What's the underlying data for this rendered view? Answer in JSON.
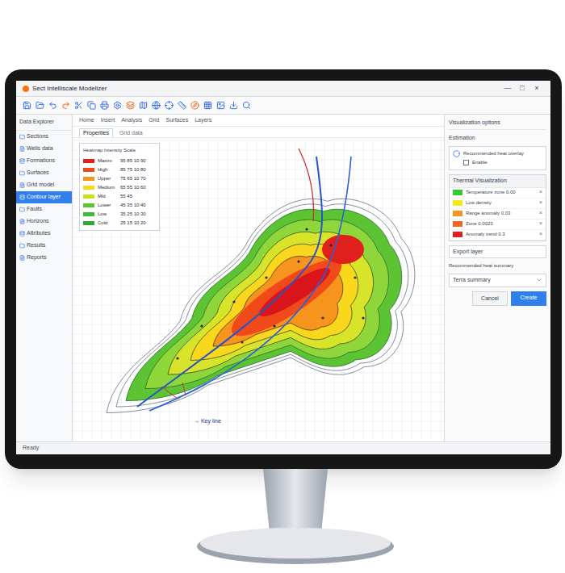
{
  "window": {
    "title": "Sect Intelliscale Modelizer",
    "controls": [
      "—",
      "□",
      "×"
    ]
  },
  "ribbon": [
    "Home",
    "Insert",
    "Analysis",
    "Grid",
    "Surfaces",
    "Layers"
  ],
  "map_tabs": [
    {
      "label": "Properties",
      "selected": true
    },
    {
      "label": "Grid data",
      "selected": false
    }
  ],
  "sidebar": {
    "header": "Data Explorer",
    "items": [
      {
        "label": "Sections",
        "selected": false
      },
      {
        "label": "Wells data",
        "selected": false
      },
      {
        "label": "Formations",
        "selected": false
      },
      {
        "label": "Surfaces",
        "selected": false
      },
      {
        "label": "Grid model",
        "selected": false
      },
      {
        "label": "Contour layer",
        "selected": true
      },
      {
        "label": "Faults",
        "selected": false
      },
      {
        "label": "Horizons",
        "selected": false
      },
      {
        "label": "Attributes",
        "selected": false
      },
      {
        "label": "Results",
        "selected": false
      },
      {
        "label": "Reports",
        "selected": false
      }
    ]
  },
  "legend": {
    "title": "Heatmap Intensity Scale",
    "rows": [
      {
        "label": "Maxim",
        "value": "95 85 10 90",
        "color": "#e0201c"
      },
      {
        "label": "High",
        "value": "85 75 10 80",
        "color": "#f04a1a"
      },
      {
        "label": "Upper",
        "value": "75 65 10 70",
        "color": "#f7941d"
      },
      {
        "label": "Medium",
        "value": "65 55 10 60",
        "color": "#f9d71c"
      },
      {
        "label": "Mid",
        "value": "55 45",
        "color": "#c8e01e"
      },
      {
        "label": "Lower",
        "value": "45 35 10 40",
        "color": "#5cc433"
      },
      {
        "label": "Low",
        "value": "35 25 10 30",
        "color": "#3db83a"
      },
      {
        "label": "Cold",
        "value": "25 15 10 20",
        "color": "#2fa83a"
      }
    ]
  },
  "map": {
    "annotation": "→ Key line"
  },
  "right_panel": {
    "title": "Visualization options",
    "section": "Estimation",
    "option": {
      "label": "Recommended heat overlay",
      "sub": "Enable",
      "checked": false
    },
    "list_title": "Thermal Visualization",
    "list_items": [
      {
        "label": "Temperature zone 0.00",
        "color": "#33cc33",
        "close": "×"
      },
      {
        "label": "Low density",
        "color": "#f2e81a",
        "close": "×"
      },
      {
        "label": "Range anomaly 0.03",
        "color": "#f7941d",
        "close": "×"
      },
      {
        "label": "Zone 0.0023",
        "color": "#f26522",
        "close": "×"
      },
      {
        "label": "Anomaly trend 0.3",
        "color": "#e0201c",
        "close": "×"
      }
    ],
    "field": "Export layer",
    "dropdown_label": "Recommended heat summary",
    "dropdown_value": "Terra summary",
    "buttons": [
      {
        "label": "Cancel",
        "primary": false
      },
      {
        "label": "Create",
        "primary": true
      }
    ]
  },
  "status_bar": {
    "left": "Ready"
  }
}
